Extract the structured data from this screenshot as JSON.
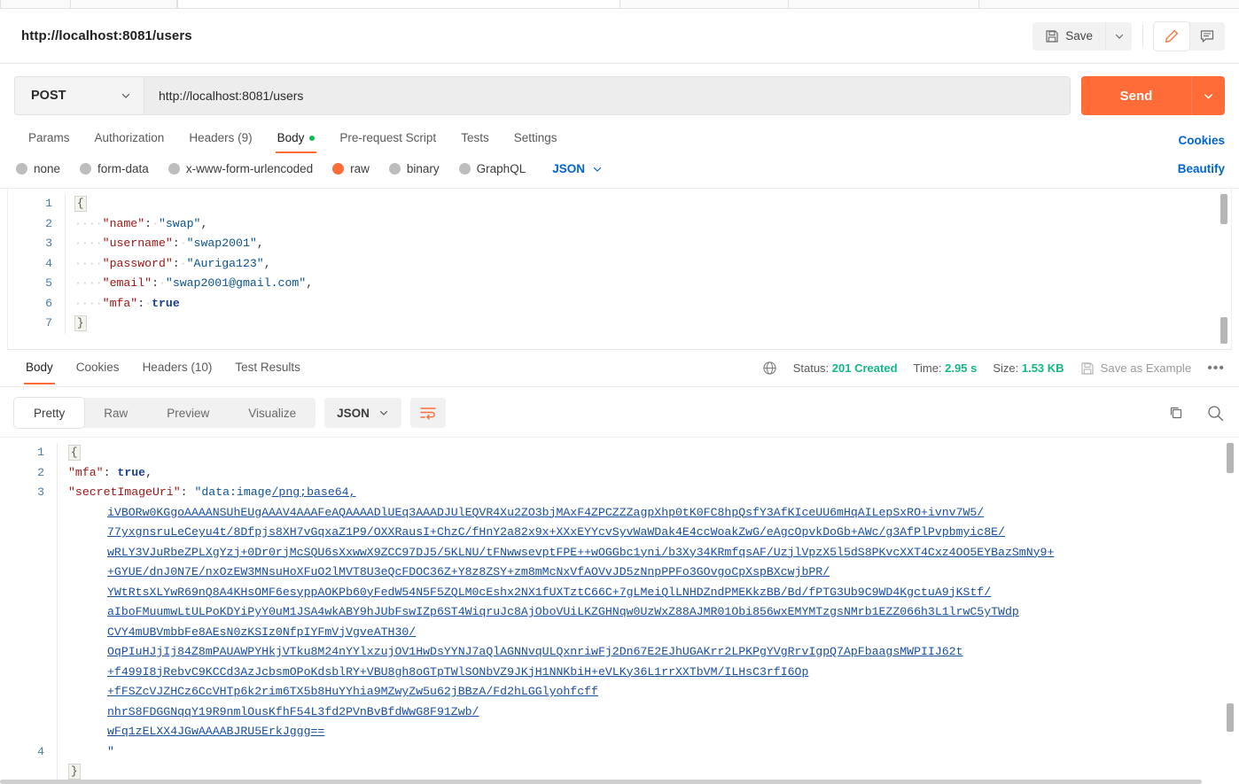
{
  "header": {
    "request_title": "http://localhost:8081/users",
    "save_label": "Save",
    "save_icon": "floppy-disk-icon",
    "save_caret_icon": "chevron-down-icon",
    "edit_icon": "pencil-icon",
    "comment_icon": "comment-icon"
  },
  "url_bar": {
    "method": "POST",
    "method_caret_icon": "chevron-down-icon",
    "url": "http://localhost:8081/users",
    "send_label": "Send",
    "send_caret_icon": "chevron-down-icon"
  },
  "request_tabs": {
    "items": [
      {
        "label": "Params",
        "active": false
      },
      {
        "label": "Authorization",
        "active": false
      },
      {
        "label": "Headers (9)",
        "active": false
      },
      {
        "label": "Body",
        "active": true,
        "dot": true
      },
      {
        "label": "Pre-request Script",
        "active": false
      },
      {
        "label": "Tests",
        "active": false
      },
      {
        "label": "Settings",
        "active": false
      }
    ],
    "cookies_link": "Cookies"
  },
  "body_modes": {
    "options": [
      {
        "label": "none",
        "selected": false
      },
      {
        "label": "form-data",
        "selected": false
      },
      {
        "label": "x-www-form-urlencoded",
        "selected": false
      },
      {
        "label": "raw",
        "selected": true
      },
      {
        "label": "binary",
        "selected": false
      },
      {
        "label": "GraphQL",
        "selected": false
      }
    ],
    "format": "JSON",
    "format_caret_icon": "chevron-down-icon",
    "beautify_label": "Beautify"
  },
  "request_body": {
    "line_numbers": [
      "1",
      "2",
      "3",
      "4",
      "5",
      "6",
      "7"
    ],
    "lines": [
      {
        "type": "brace",
        "text": "{"
      },
      {
        "type": "pair",
        "key": "\"name\"",
        "value": "\"swap\"",
        "value_kind": "string",
        "comma": true
      },
      {
        "type": "pair",
        "key": "\"username\"",
        "value": "\"swap2001\"",
        "value_kind": "string",
        "comma": true
      },
      {
        "type": "pair",
        "key": "\"password\"",
        "value": "\"Auriga123\"",
        "value_kind": "string",
        "comma": true
      },
      {
        "type": "pair",
        "key": "\"email\"",
        "value": "\"swap2001@gmail.com\"",
        "value_kind": "string",
        "comma": true
      },
      {
        "type": "pair",
        "key": "\"mfa\"",
        "value": "true",
        "value_kind": "boolean",
        "comma": false
      },
      {
        "type": "brace",
        "text": "}"
      }
    ]
  },
  "response_tabs": {
    "items": [
      {
        "label": "Body",
        "active": true
      },
      {
        "label": "Cookies",
        "active": false
      },
      {
        "label": "Headers (10)",
        "active": false
      },
      {
        "label": "Test Results",
        "active": false
      }
    ]
  },
  "response_meta": {
    "globe_icon": "globe-icon",
    "status_label": "Status:",
    "status_value": "201 Created",
    "time_label": "Time:",
    "time_value": "2.95 s",
    "size_label": "Size:",
    "size_value": "1.53 KB",
    "save_example_label": "Save as Example",
    "save_example_icon": "floppy-disk-icon",
    "more_icon": "ellipsis-icon"
  },
  "response_toolbar": {
    "views": [
      {
        "label": "Pretty",
        "active": true
      },
      {
        "label": "Raw",
        "active": false
      },
      {
        "label": "Preview",
        "active": false
      },
      {
        "label": "Visualize",
        "active": false
      }
    ],
    "format": "JSON",
    "format_caret_icon": "chevron-down-icon",
    "wrap_icon": "word-wrap-icon",
    "copy_icon": "copy-icon",
    "search_icon": "search-icon"
  },
  "response_body": {
    "line_numbers": [
      "1",
      "2",
      "3",
      "4"
    ],
    "open_brace": "{",
    "close_brace": "}",
    "mfa_key": "\"mfa\"",
    "mfa_value": "true",
    "secret_key": "\"secretImageUri\"",
    "secret_prefix_plain": "\"data:image",
    "secret_prefix_link": "/png;base64,",
    "base64_lines": [
      "iVBORw0KGgoAAAANSUhEUgAAAV4AAAFeAQAAAADlUEq3AAADJUlEQVR4Xu2ZO3bjMAxF4ZPCZZZagpXhp0tK0FC8hpQsfY3AfKIceUU6mHqAILepSxRO+ivnv7W5/",
      "77yxgnsruLeCeyu4t/8Dfpjs8XH7vGqxaZ1P9/OXXRausI+ChzC/fHnY2a82x9x+XXxEYYcvSyvWaWDak4E4ccWoakZwG/eAgcOpvkDoGb+AWc/g3AfPlPvpbmyic8E/",
      "wRLY3VJuRbeZPLXgYzj+0Dr0rjMcSQU6sXxwwX9ZCC97DJ5/5KLNU/tFNwwsevptFPE++wOGGbc1yni/b3Xy34KRmfqsAF/UzjlVpzX5l5dS8PKvcXXT4Cxz4OO5EYBazSmNy9+",
      "+GYUE/dnJ0N7E/nxOzEW3MNsuHoXFuO2lMVT8U3eQcFDOC36Z+Y8z8ZSY+zm8mMcNxVfAOVvJD5zNnpPPFo3GOvgoCpXspBXcwjbPR/",
      "YWtRtsXLYwR69nQ8A4KHsOMF6esyppAOKPb60yFedW54N5F5ZQLM0cEshx2NX1fUXTztC66C+7gLMeiQlLNHDZndPMEKkzBB/Bd/fPTG3Ub9C9WD4KgctuA9jKStf/",
      "aIboFMuumwLtULPoKDYiPyY0uM1JSA4wkABY9hJUbFswIZp6ST4WiqruJc8AjOboVUiLKZGHNqw0UzWxZ88AJMR01Obi856wxEMYMTzgsNMrb1EZZ066h3L1lrwC5yTWdp",
      "CVY4mUBVmbbFe8AEsN0zKSIz0NfpIYFmVjVgveATH30/",
      "OqPIuHJjIj84Z8mPAUAWPYHkjVTku8M24nYYlxzujOV1HwDsYYNJ7aQlAGNNvqULQxnriwFj2Dn67E2EJhUGAKrr2LPKPgYVgRrvIgpQ7ApFbaagsMWPIIJ62t",
      "+f499I8jRebvC9KCCd3AzJcbsmOPoKdsblRY+VBU8gh8oGTpTWlSONbVZ9JKjH1NNKbiH+eVLKy36L1rrXXTbVM/ILHsC3rfI6Op",
      "+fFSZcVJZHCz6CcVHTp6k2rim6TX5b8HuYYhia9MZwyZw5u62jBBzA/Fd2hLGGlyohfcff",
      "nhrS8FDGGNqqY19R9nmlOusKfhF54L3fd2PVnBvBfdWwG8F91Zwb/",
      "wFq1zELXX4JGwAAAABJRU5ErkJggg=="
    ],
    "closing_quote": "\""
  }
}
